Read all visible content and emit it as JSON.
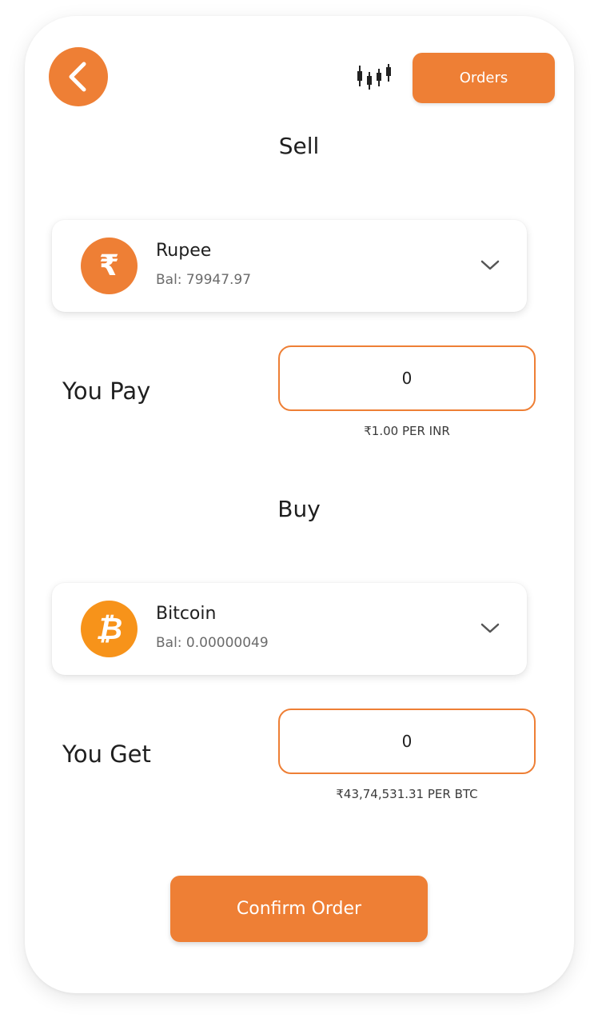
{
  "header": {
    "back_icon": "chevron-left-icon",
    "chart_icon": "candlestick-chart-icon",
    "orders_label": "Orders"
  },
  "sell": {
    "title": "Sell",
    "asset": {
      "name": "Rupee",
      "symbol_glyph": "₹",
      "balance": "Bal: 79947.97",
      "icon": "rupee-icon",
      "icon_color": "#EE7F35"
    },
    "label": "You Pay",
    "input_value": "0",
    "rate": "₹1.00 PER INR"
  },
  "buy": {
    "title": "Buy",
    "asset": {
      "name": "Bitcoin",
      "symbol_glyph": "₿",
      "balance": "Bal: 0.00000049",
      "icon": "bitcoin-icon",
      "icon_color": "#F7931A"
    },
    "label": "You Get",
    "input_value": "0",
    "rate": "₹43,74,531.31 PER BTC"
  },
  "confirm_label": "Confirm Order",
  "colors": {
    "accent": "#EE7F35",
    "bitcoin": "#F7931A"
  }
}
